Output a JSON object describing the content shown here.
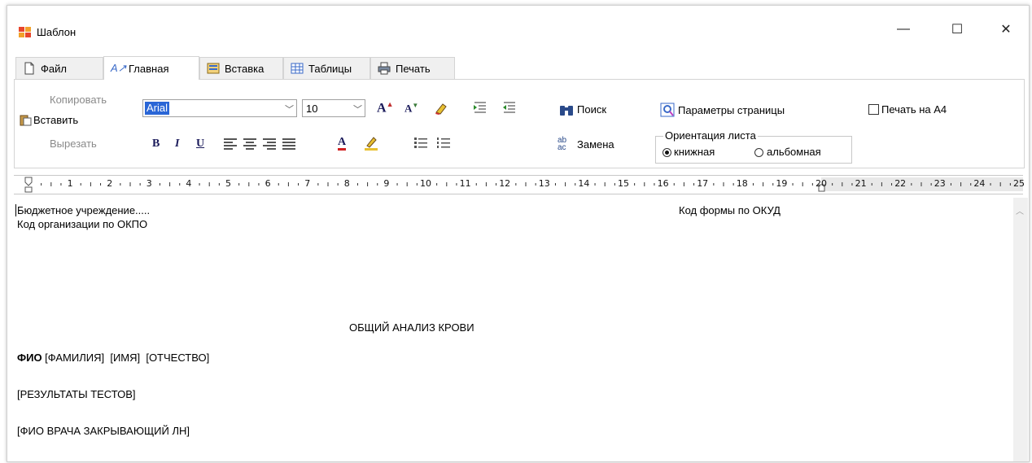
{
  "window": {
    "title": "Шаблон",
    "minimize_glyph": "—",
    "maximize_glyph": "☐",
    "close_glyph": "✕"
  },
  "tabs": [
    {
      "label": "Файл",
      "icon": "file-icon",
      "active": false
    },
    {
      "label": "Главная",
      "icon": "font-style-icon",
      "active": true
    },
    {
      "label": "Вставка",
      "icon": "insert-icon",
      "active": false
    },
    {
      "label": "Таблицы",
      "icon": "table-icon",
      "active": false
    },
    {
      "label": "Печать",
      "icon": "printer-icon",
      "active": false
    }
  ],
  "clipboard": {
    "copy_label": "Копировать",
    "paste_label": "Вставить",
    "cut_label": "Вырезать"
  },
  "font": {
    "family": "Arial",
    "size": "10",
    "bold_glyph": "B",
    "italic_glyph": "I",
    "underline_glyph": "U",
    "grow_glyph": "A",
    "shrink_glyph": "A",
    "color_glyph": "A"
  },
  "search": {
    "find_label": "Поиск",
    "replace_label": "Замена"
  },
  "page": {
    "params_label": "Параметры страницы",
    "print_a4_label": "Печать на А4",
    "print_a4_checked": false,
    "orientation_title": "Ориентация листа",
    "portrait_label": "книжная",
    "landscape_label": "альбомная",
    "orientation_selected": "книжная"
  },
  "ruler": {
    "numbers": [
      "1",
      "2",
      "3",
      "4",
      "5",
      "6",
      "7",
      "8",
      "9",
      "10",
      "11",
      "12",
      "13",
      "14",
      "15",
      "16",
      "17",
      "18",
      "19",
      "20",
      "21",
      "22",
      "23",
      "24",
      "25"
    ]
  },
  "document": {
    "line1": "Бюджетное учреждение.....",
    "line1_right": "Код формы по ОКУД",
    "line2": "Код организации по ОКПО",
    "heading": "ОБЩИЙ АНАЛИЗ КРОВИ",
    "fio_label": "ФИО",
    "fio_fields": " [ФАМИЛИЯ]  [ИМЯ]  [ОТЧЕСТВО]",
    "results": "[РЕЗУЛЬТАТЫ ТЕСТОВ]",
    "doctor": "[ФИО ВРАЧА ЗАКРЫВАЮЩИЙ ЛН]"
  },
  "colors": {
    "accent_selection": "#2a66d6",
    "window_border": "#d0d0d0",
    "tab_inactive_bg": "#f0f0f0"
  }
}
